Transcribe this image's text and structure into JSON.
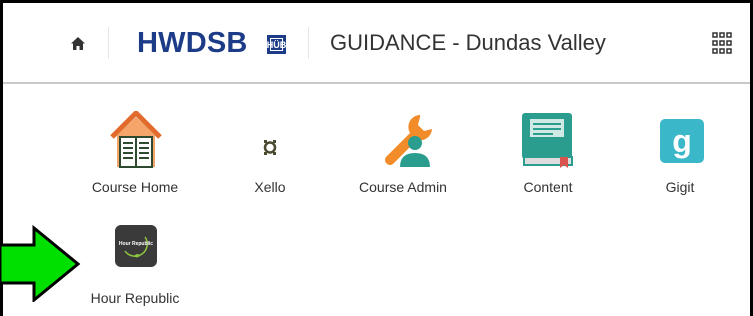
{
  "header": {
    "home_icon": "home-icon",
    "brand": "HWDSB",
    "brand_badge": "HÜB",
    "org_unit": "GUIDANCE - Dundas Valley",
    "apps_icon": "waffle-grid-icon"
  },
  "tiles": [
    {
      "label": "Course Home",
      "icon": "house-book-icon"
    },
    {
      "label": "Xello",
      "icon": "xello-icon"
    },
    {
      "label": "Course Admin",
      "icon": "wrench-person-icon"
    },
    {
      "label": "Content",
      "icon": "book-icon"
    },
    {
      "label": "Gigit",
      "icon": "gigit-icon"
    },
    {
      "label": "Hour Republic",
      "icon": "hour-republic-icon",
      "logo_text": "Hour Republic"
    }
  ],
  "colors": {
    "brand_blue": "#1d3c87",
    "house_orange": "#e06b2c",
    "wrench_orange": "#f28c28",
    "teal": "#2a9d8f",
    "gigit_teal": "#3ab7c8",
    "arrow_green": "#00e000"
  }
}
